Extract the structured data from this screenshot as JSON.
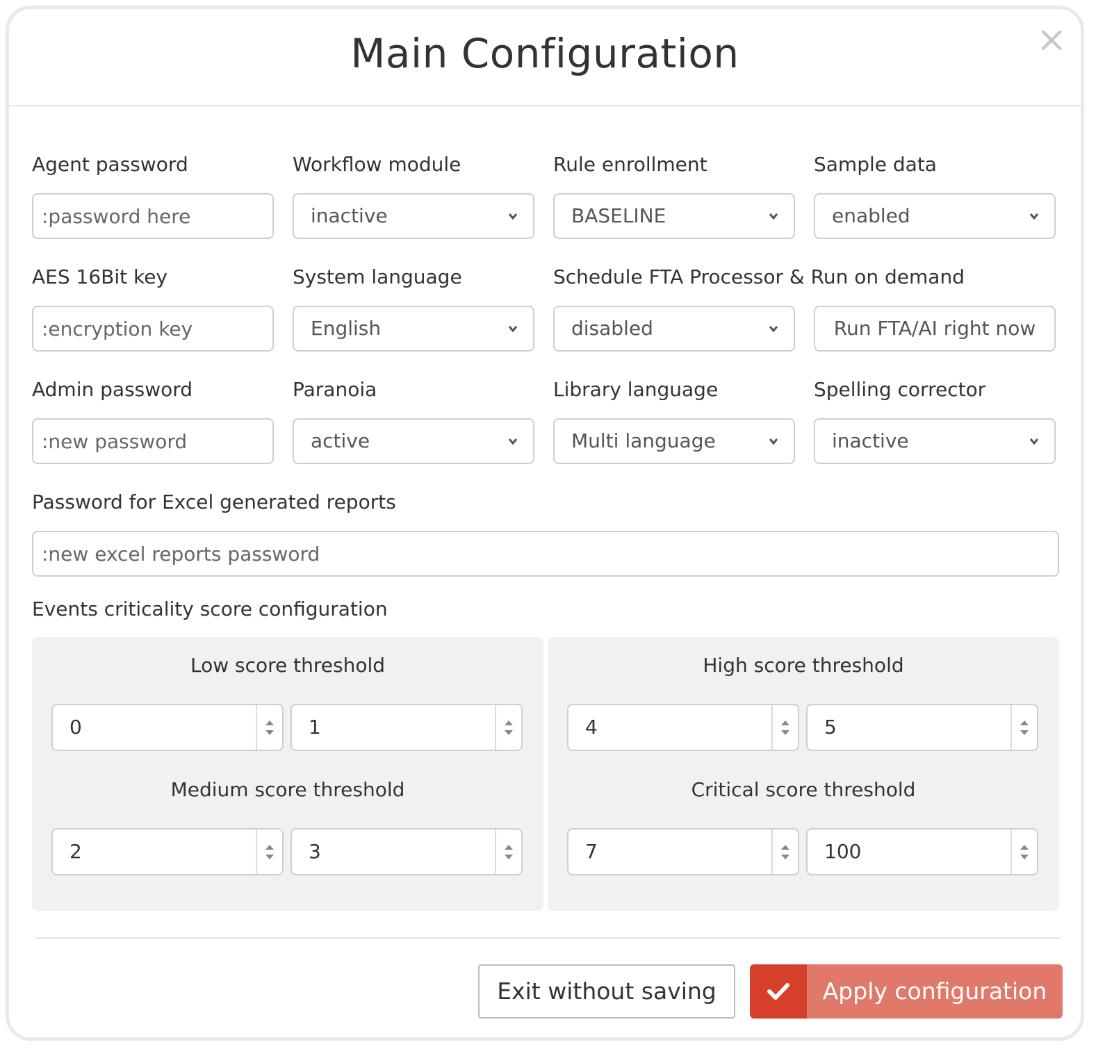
{
  "dialog": {
    "title": "Main Configuration",
    "close_icon": "×"
  },
  "fields": {
    "agent_password": {
      "label": "Agent password",
      "placeholder": ":password here"
    },
    "workflow_module": {
      "label": "Workflow module",
      "value": "inactive"
    },
    "rule_enrollment": {
      "label": "Rule enrollment",
      "value": "BASELINE"
    },
    "sample_data": {
      "label": "Sample data",
      "value": "enabled"
    },
    "aes_key": {
      "label": "AES 16Bit key",
      "placeholder": ":encryption key"
    },
    "system_language": {
      "label": "System language",
      "value": "English"
    },
    "schedule_fta": {
      "label": "Schedule FTA Processor & Run on demand",
      "value": "disabled",
      "run_button": "Run FTA/AI right now"
    },
    "admin_password": {
      "label": "Admin password",
      "placeholder": ":new password"
    },
    "paranoia": {
      "label": "Paranoia",
      "value": "active"
    },
    "library_language": {
      "label": "Library language",
      "value": "Multi language"
    },
    "spelling_corrector": {
      "label": "Spelling corrector",
      "value": "inactive"
    },
    "excel_password": {
      "label": "Password for Excel generated reports",
      "placeholder": ":new excel reports password"
    }
  },
  "scores": {
    "section_label": "Events criticality score configuration",
    "low": {
      "label": "Low score threshold",
      "min": "0",
      "max": "1"
    },
    "medium": {
      "label": "Medium score threshold",
      "min": "2",
      "max": "3"
    },
    "high": {
      "label": "High score threshold",
      "min": "4",
      "max": "5"
    },
    "critical": {
      "label": "Critical score threshold",
      "min": "7",
      "max": "100"
    }
  },
  "footer": {
    "exit_label": "Exit without saving",
    "apply_label": "Apply configuration"
  },
  "colors": {
    "apply_icon_bg": "#d6402a",
    "apply_text_bg": "#e0796a"
  }
}
